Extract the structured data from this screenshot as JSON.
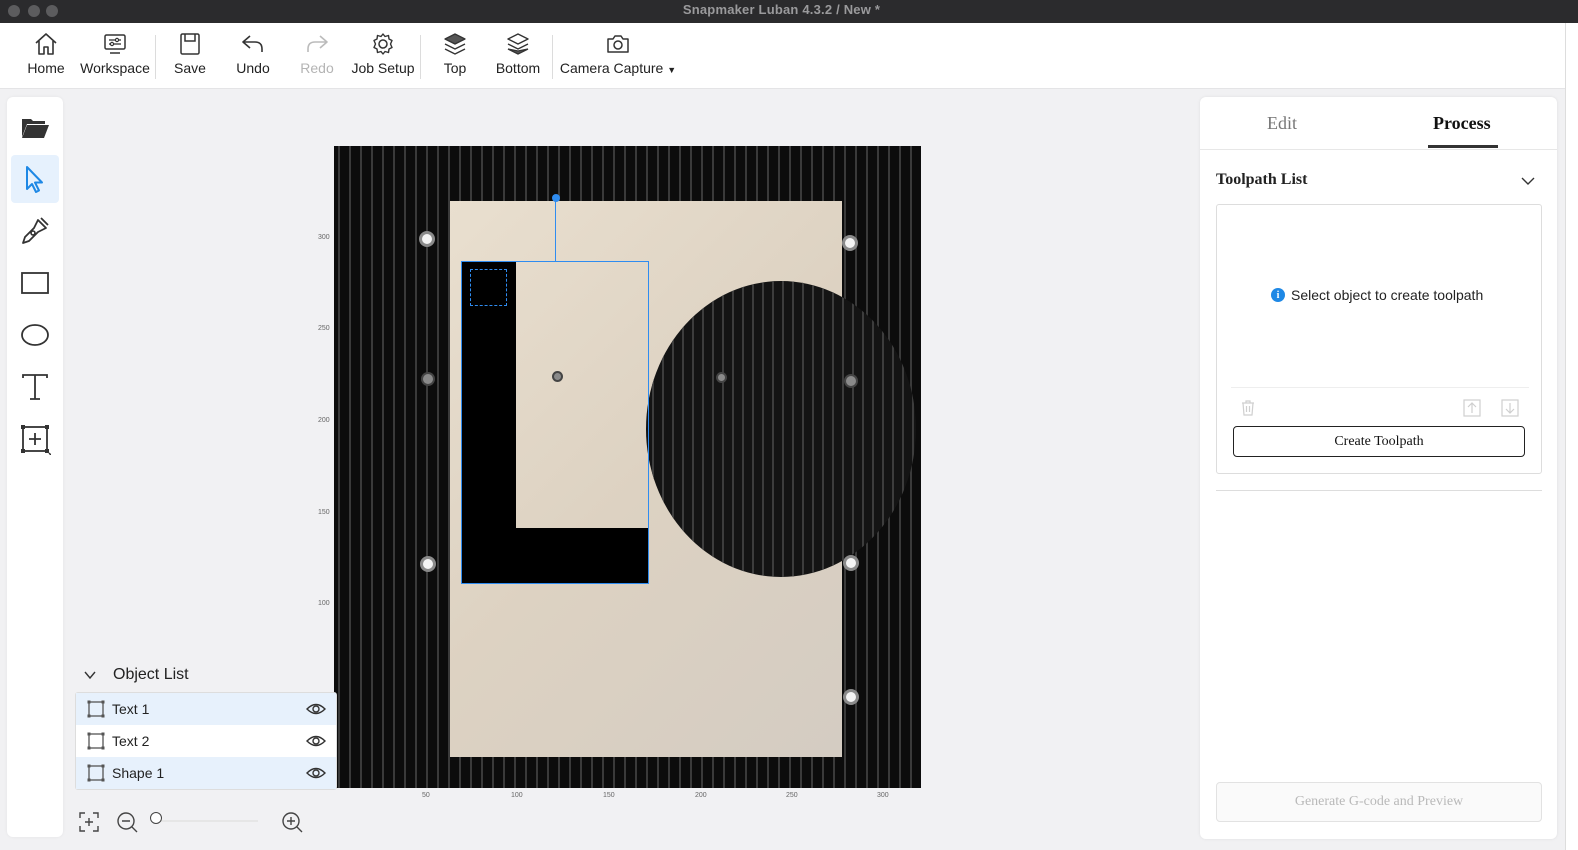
{
  "window": {
    "title": "Snapmaker Luban 4.3.2 / New *"
  },
  "toolbar": {
    "home": "Home",
    "workspace": "Workspace",
    "save": "Save",
    "undo": "Undo",
    "redo": "Redo",
    "job_setup": "Job Setup",
    "top": "Top",
    "bottom": "Bottom",
    "camera_capture": "Camera Capture"
  },
  "left_tools": [
    "open-file",
    "select",
    "pen",
    "rectangle",
    "ellipse",
    "text",
    "add-frame"
  ],
  "active_tool": "select",
  "rulers": {
    "y": [
      "300",
      "250",
      "200",
      "150",
      "100"
    ],
    "x": [
      "50",
      "100",
      "150",
      "200",
      "250",
      "300"
    ]
  },
  "object_list": {
    "title": "Object List",
    "items": [
      {
        "label": "Text 1",
        "selected": true
      },
      {
        "label": "Text 2",
        "selected": false
      },
      {
        "label": "Shape 1",
        "selected": true
      }
    ]
  },
  "right_panel": {
    "tabs": [
      "Edit",
      "Process"
    ],
    "active_tab": "Process",
    "toolpath_title": "Toolpath List",
    "empty_message": "Select object to create toolpath",
    "create_button": "Create Toolpath",
    "generate_button": "Generate G-code and Preview"
  },
  "colors": {
    "accent": "#2f8cf0",
    "info": "#1e88e5"
  }
}
